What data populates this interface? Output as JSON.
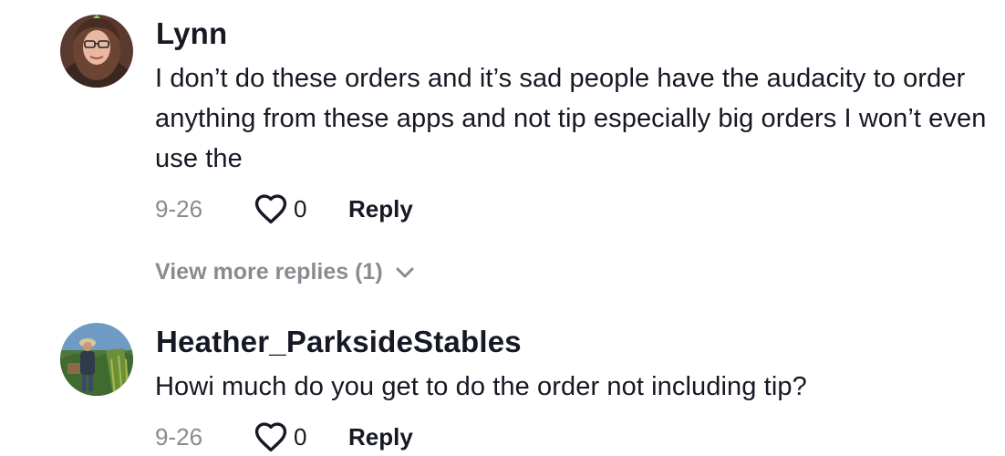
{
  "comments": [
    {
      "username": "Lynn",
      "text": "I don’t do these orders and it’s sad people have the audacity to order anything from these apps and not tip especially big orders I won’t even use the",
      "date": "9-26",
      "likes": "0",
      "reply_label": "Reply"
    },
    {
      "username": "Heather_ParksideStables",
      "text": "Howi much do you get to do the order not including tip?",
      "date": "9-26",
      "likes": "0",
      "reply_label": "Reply"
    }
  ],
  "view_more_replies": "View more replies (1)",
  "icons": {
    "like": "heart-outline-icon",
    "expand": "chevron-down-icon"
  },
  "colors": {
    "primary_text": "#161823",
    "secondary_text": "#8a8b91"
  }
}
